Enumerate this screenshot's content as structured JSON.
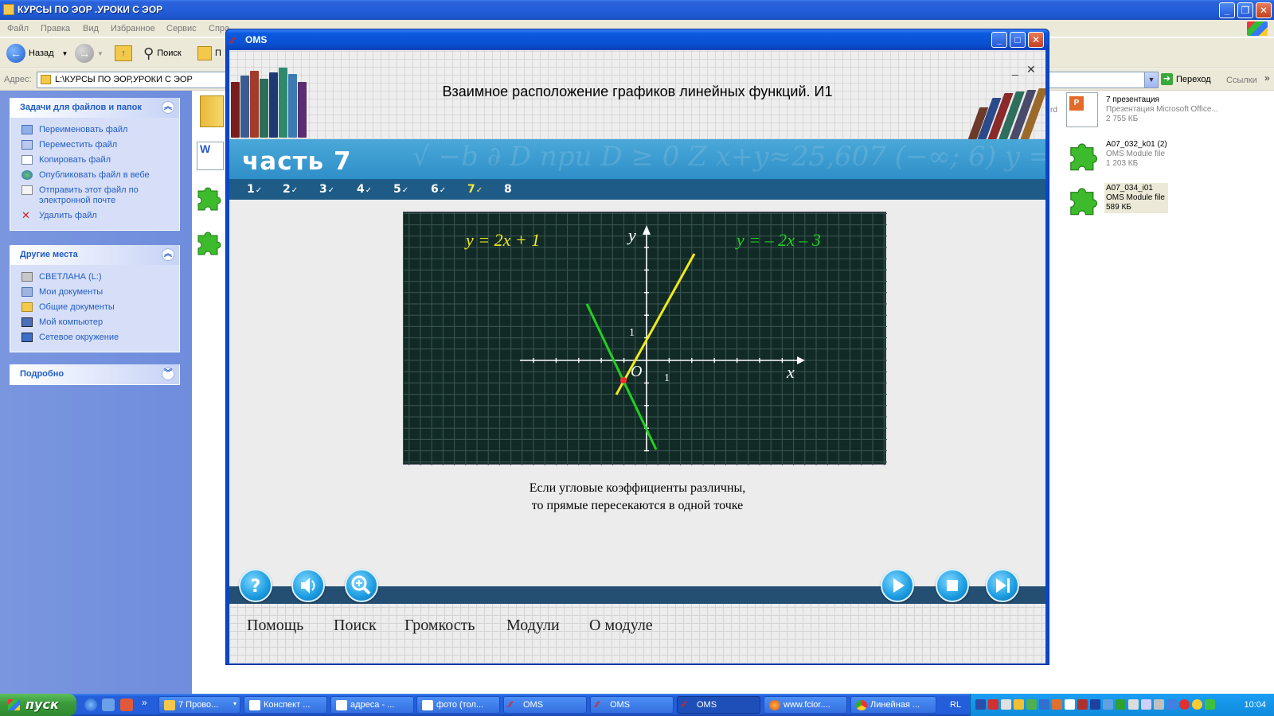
{
  "explorer": {
    "title": "КУРСЫ ПО ЭОР .УРОКИ С ЭОР",
    "menu": [
      "Файл",
      "Правка",
      "Вид",
      "Избранное",
      "Сервис",
      "Спра"
    ],
    "toolbar": {
      "back": "Назад",
      "search": "Поиск",
      "folders": "П"
    },
    "address_label": "Адрес:",
    "address_value": "L:\\КУРСЫ ПО ЭОР,УРОКИ С ЭОР",
    "go_label": "Переход",
    "links_label": "Ссылки",
    "tasks_panel": {
      "title": "Задачи для файлов и папок",
      "items": [
        "Переименовать файл",
        "Переместить файл",
        "Копировать файл",
        "Опубликовать файл в вебе",
        "Отправить этот файл по электронной почте",
        "Удалить файл"
      ]
    },
    "places_panel": {
      "title": "Другие места",
      "items": [
        "СВЕТЛАНА (L:)",
        "Мои документы",
        "Общие документы",
        "Мой компьютер",
        "Сетевое окружение"
      ]
    },
    "details_panel": {
      "title": "Подробно"
    },
    "files": [
      {
        "name": "7 презентация",
        "type": "Презентация Microsoft Office...",
        "size": "2 755 КБ"
      },
      {
        "name": "A07_032_k01 (2)",
        "type": "OMS Module file",
        "size": "1 203 КБ"
      },
      {
        "name": "A07_034_i01",
        "type": "OMS Module file",
        "size": "589 КБ"
      }
    ],
    "partial_label": "rd"
  },
  "oms": {
    "window_title": "OMS",
    "lesson_title": "Взаимное расположение графиков линейных функций. И1",
    "part_label": "часть 7",
    "steps": [
      {
        "label": "1",
        "check": "✓"
      },
      {
        "label": "2",
        "check": "✓"
      },
      {
        "label": "3",
        "check": "✓"
      },
      {
        "label": "4",
        "check": "✓"
      },
      {
        "label": "5",
        "check": "✓"
      },
      {
        "label": "6",
        "check": "✓"
      },
      {
        "label": "7",
        "check": "✓"
      },
      {
        "label": "8",
        "check": ""
      }
    ],
    "active_step": "7",
    "graph": {
      "eq1": "y = 2x + 1",
      "eq2": "y = – 2x – 3",
      "axis_x": "x",
      "axis_y": "y",
      "origin": "O",
      "tick_one_x": "1",
      "tick_one_y": "1",
      "colors": {
        "line1": "#f0ea1a",
        "line2": "#1fd21f",
        "intersection": "#ff2a2a",
        "background": "#112a26",
        "grid": "#3c5753"
      }
    },
    "caption_line1": "Если угловые коэффициенты различны,",
    "caption_line2": "то прямые пересекаются в одной точке",
    "controls_left": [
      "help-icon",
      "volume-icon",
      "zoom-icon"
    ],
    "controls_right": [
      "play-icon",
      "stop-icon",
      "skip-end-icon"
    ],
    "bottom_menu": [
      "Помощь",
      "Поиск",
      "Громкость",
      "Модули",
      "О модуле"
    ]
  },
  "taskbar": {
    "start_label": "пуск",
    "tasks": [
      {
        "label": "7 Прово...",
        "has_arrow": true
      },
      {
        "label": "Конспект ..."
      },
      {
        "label": "адреса - ..."
      },
      {
        "label": "фото (тол..."
      },
      {
        "label": "OMS"
      },
      {
        "label": "OMS"
      },
      {
        "label": "OMS",
        "active": true
      },
      {
        "label": "www.fcior...."
      },
      {
        "label": "Линейная ..."
      }
    ],
    "language": "RL",
    "clock": "10:04"
  }
}
